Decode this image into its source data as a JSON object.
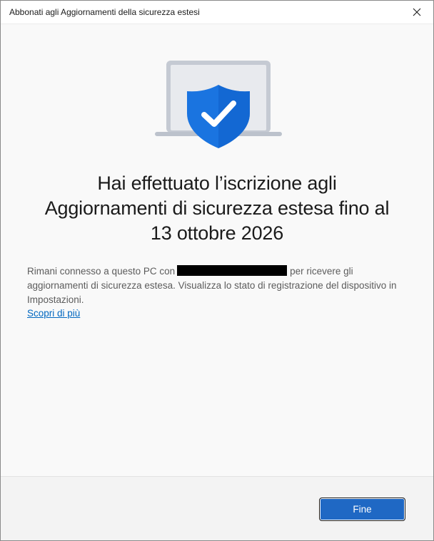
{
  "window": {
    "title": "Abbonati agli Aggiornamenti della sicurezza estesi"
  },
  "icons": {
    "close": "close-icon",
    "illustration": "shield-check-laptop-icon"
  },
  "main": {
    "headline_lines": [
      "Hai effettuato l’iscrizione agli",
      "Aggiornamenti di sicurezza estesa fino al",
      "13 ottobre 2026"
    ],
    "body_before": "Rimani connesso a questo PC con",
    "body_after": "per ricevere gli aggiornamenti di sicurezza estesa. Visualizza lo stato di registrazione del dispositivo in Impostazioni.",
    "learn_more": "Scopri di più"
  },
  "footer": {
    "done_label": "Fine"
  },
  "colors": {
    "accent": "#1f68c4",
    "link": "#0067c0",
    "shield": "#1a74e0"
  }
}
